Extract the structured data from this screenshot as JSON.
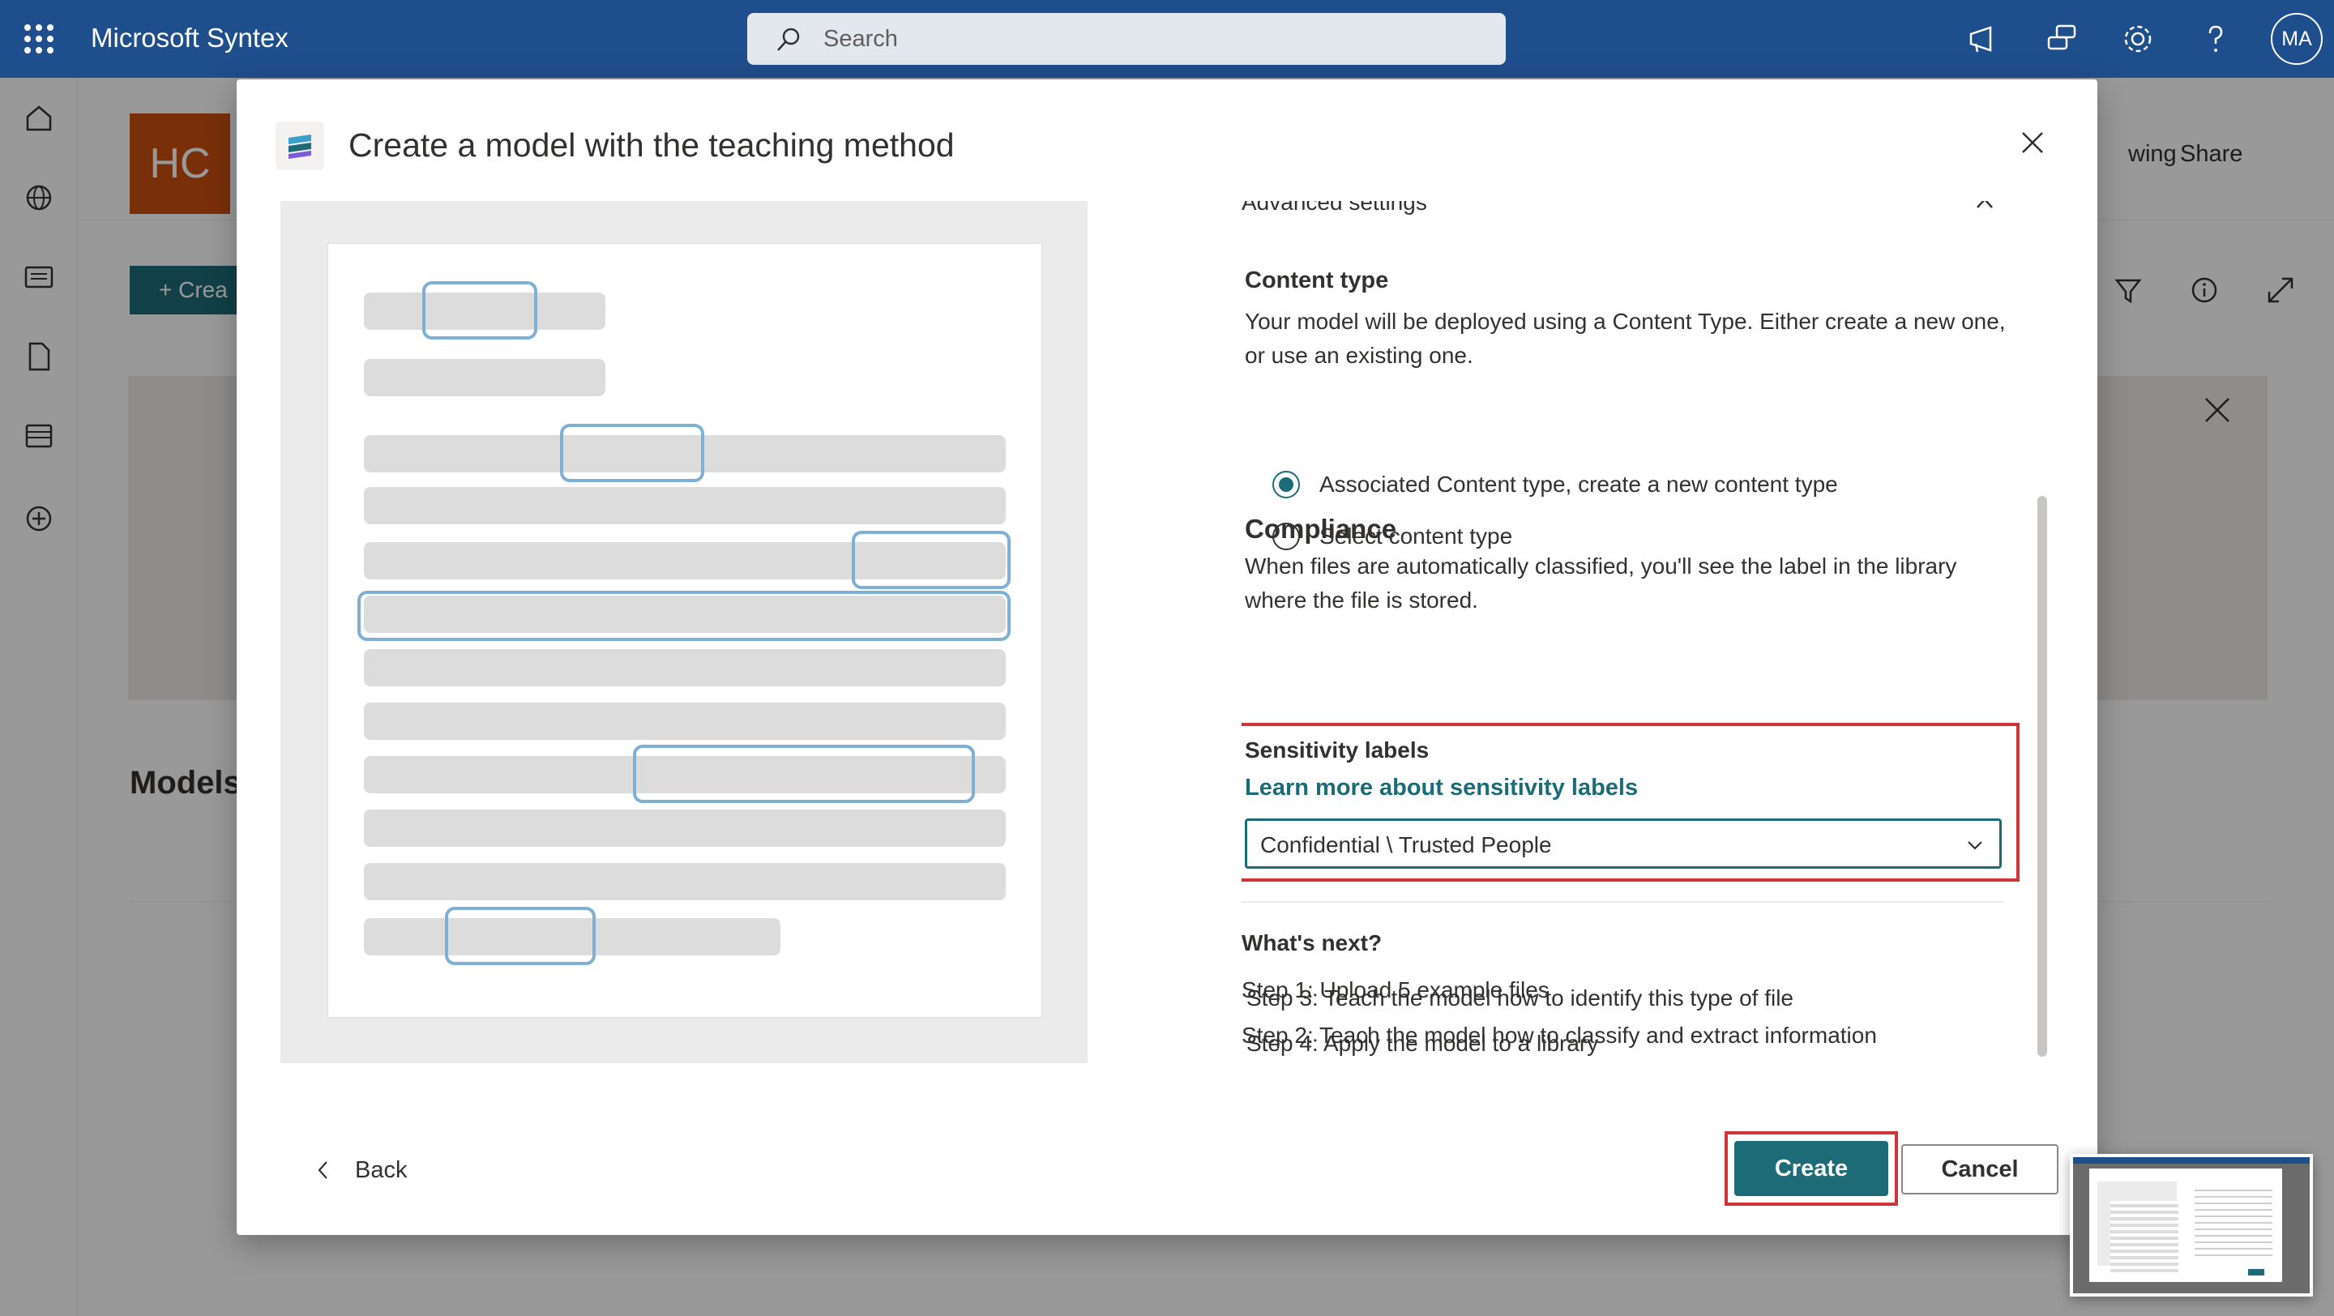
{
  "app": {
    "title": "Microsoft Syntex",
    "user_initials": "MA"
  },
  "search": {
    "placeholder": "Search"
  },
  "background": {
    "site_initials": "HC",
    "following_label": "wing",
    "share_label": "Share",
    "new_button_label": "Crea",
    "models_heading": "Models"
  },
  "dialog": {
    "title": "Create a model with the teaching method",
    "advanced_settings": "Advanced settings",
    "content_type": {
      "title": "Content type",
      "description": "Your model will be deployed using a Content Type. Either create a new one, or use an existing one.",
      "options": [
        {
          "label": "Associated Content type, create a new content type",
          "selected": true
        },
        {
          "label": "Select content type",
          "selected": false
        }
      ]
    },
    "compliance": {
      "title": "Compliance",
      "description": "When files are automatically classified, you'll see the label in the library where the file is stored."
    },
    "sensitivity": {
      "title": "Sensitivity labels",
      "link": "Learn more about sensitivity labels",
      "selected": "Confidential \\ Trusted People"
    },
    "whats_next": {
      "title": "What's next?",
      "steps": [
        "Step 1: Upload 5 example files",
        "Step 2: Teach the model how to classify and extract information",
        "Step 3: Teach the model how to identify this type of file",
        "Step 4: Apply the model to a library"
      ]
    },
    "back_label": "Back",
    "create_label": "Create",
    "cancel_label": "Cancel"
  },
  "colors": {
    "topbar": "#1f4e8c",
    "accent": "#1e6b78",
    "highlight_outline": "#d13438",
    "preview_highlight": "#7eb0d6",
    "site_logo": "#ca5010"
  },
  "icons": [
    "waffle-icon",
    "search-icon",
    "megaphone-icon",
    "chat-icon",
    "gear-icon",
    "help-icon",
    "home-icon",
    "globe-icon",
    "news-icon",
    "file-icon",
    "list-icon",
    "add-icon",
    "close-icon",
    "chevron-down-icon",
    "chevron-up-icon",
    "chevron-left-icon",
    "filter-icon",
    "info-icon",
    "expand-icon",
    "share-icon"
  ]
}
